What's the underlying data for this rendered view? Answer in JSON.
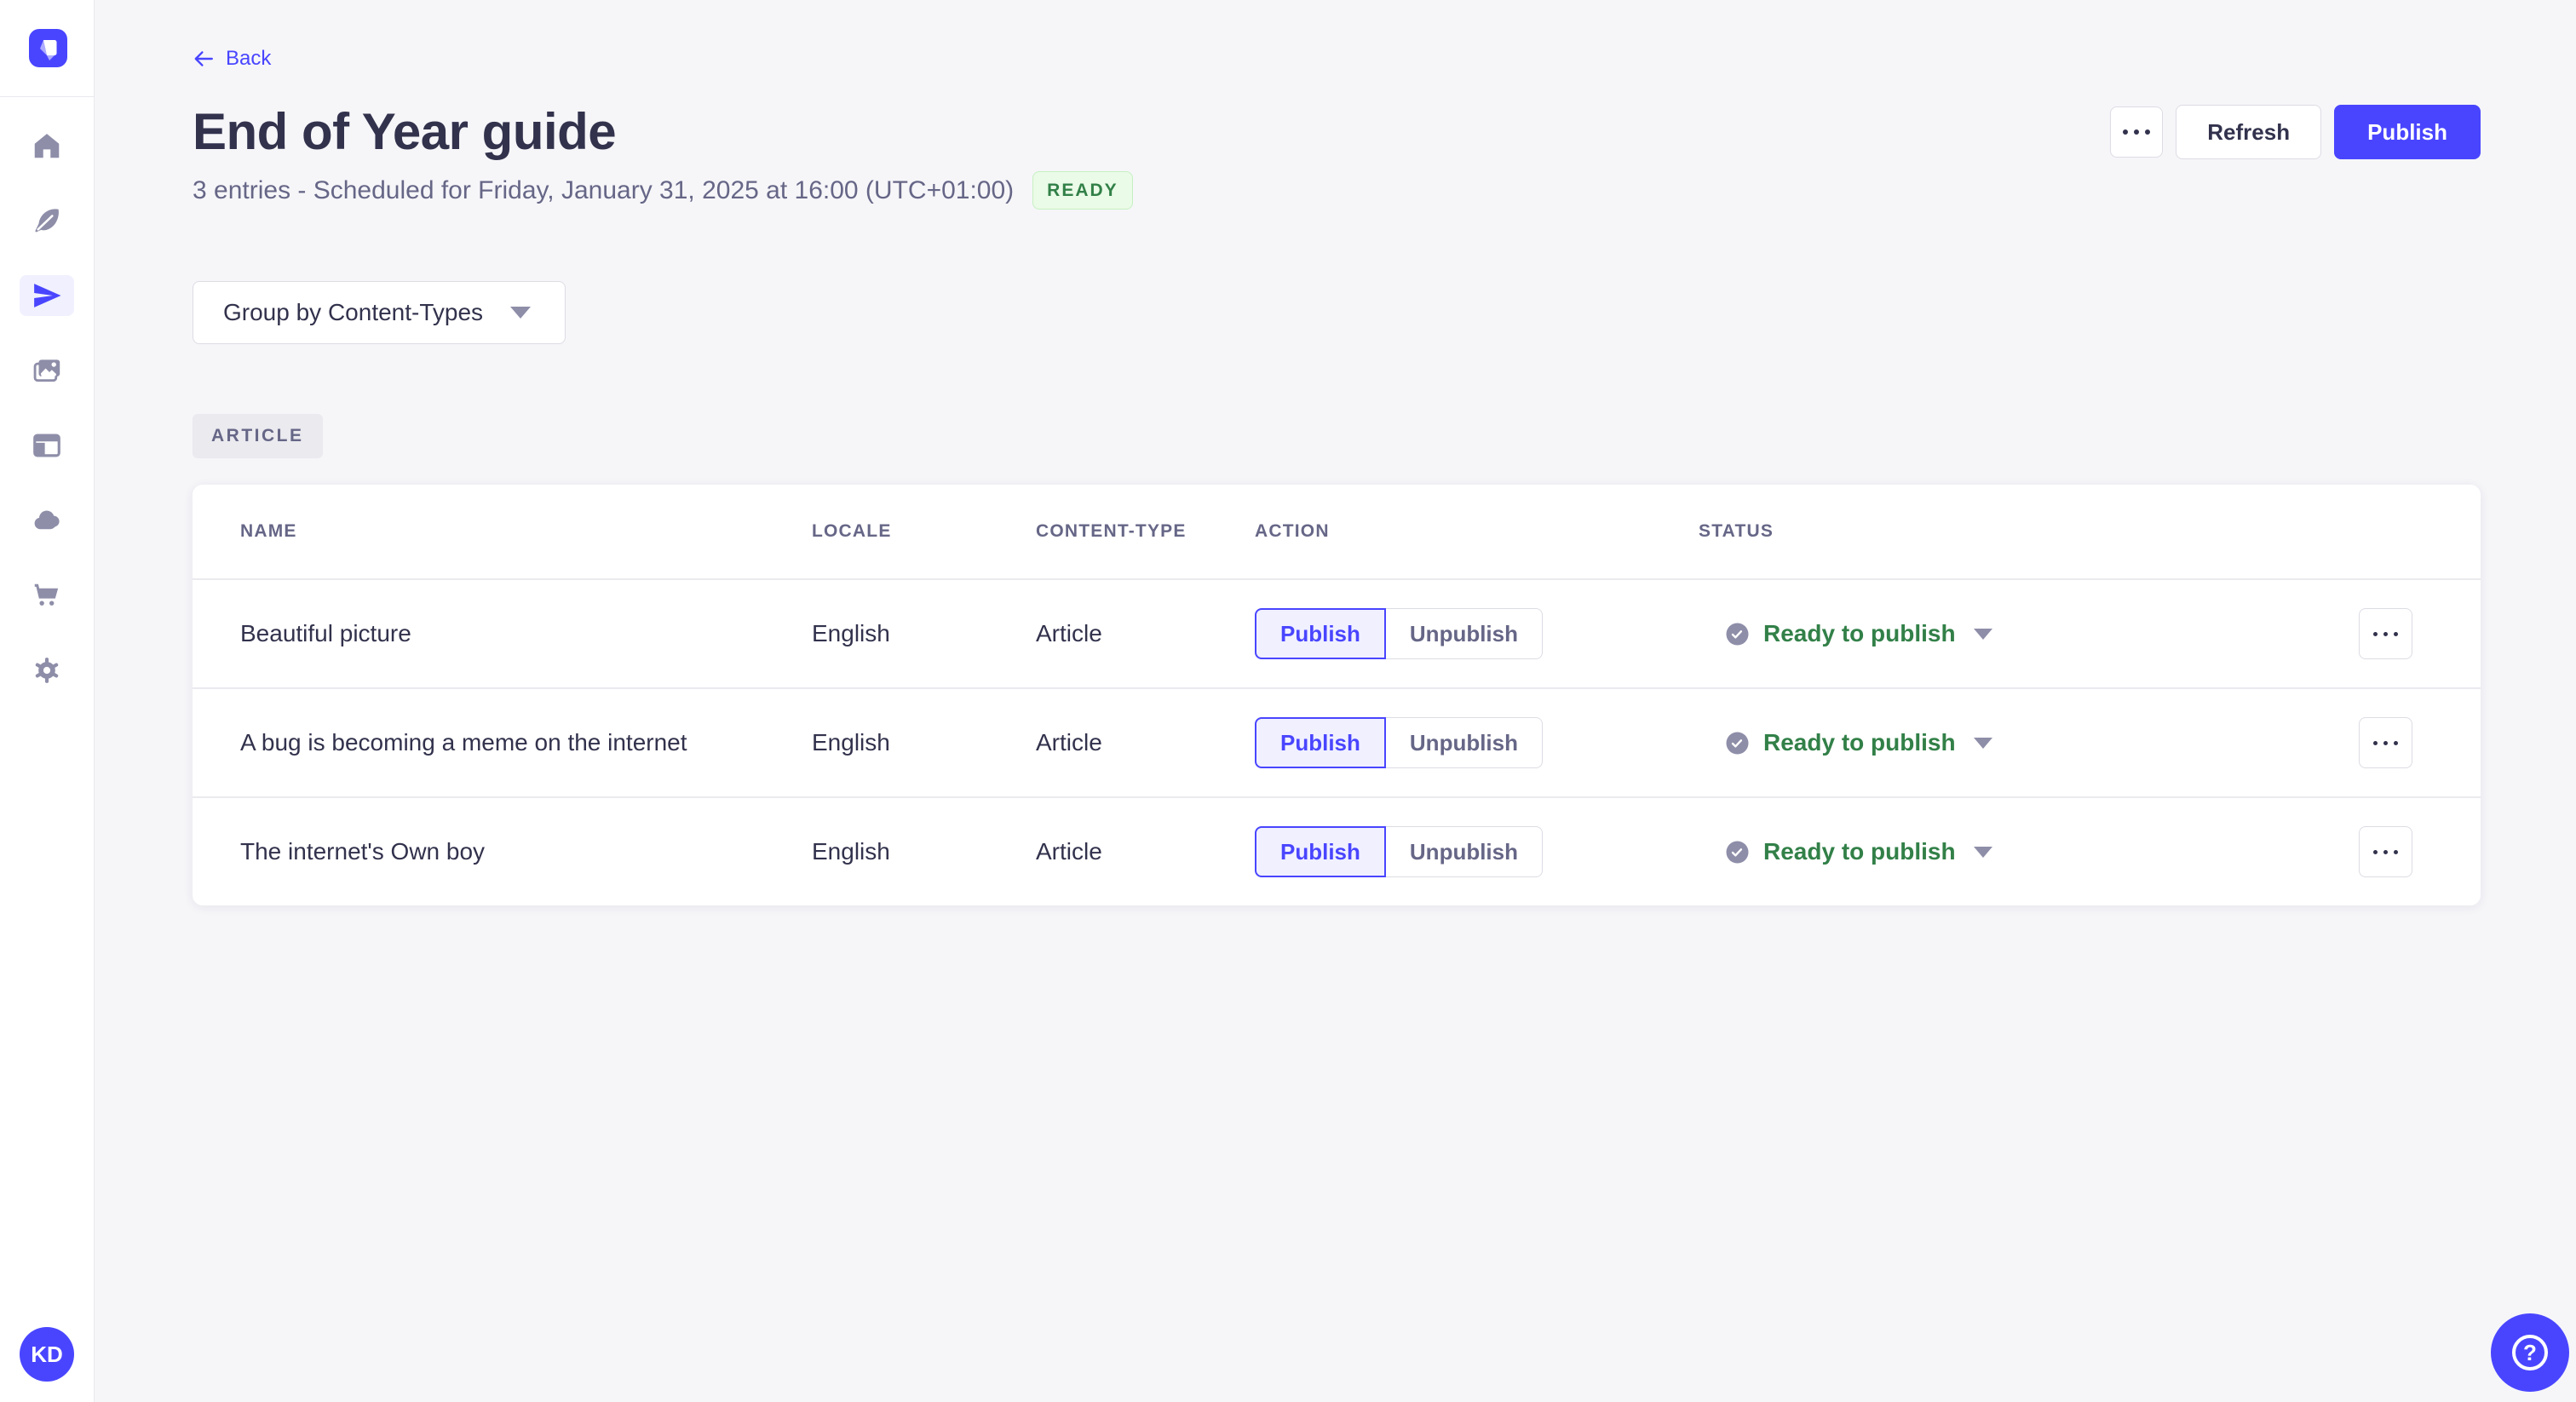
{
  "colors": {
    "primary": "#4945ff",
    "primary_light": "#f0f0ff",
    "success_text": "#328048",
    "success_bg": "#eafbe7",
    "neutral_icon": "#8e8ea9"
  },
  "sidebar": {
    "icons": [
      "home-icon",
      "feather-icon",
      "paper-plane-icon",
      "images-icon",
      "layout-icon",
      "cloud-icon",
      "cart-icon",
      "gear-icon"
    ],
    "active_icon": "paper-plane-icon",
    "avatar_initials": "KD"
  },
  "header": {
    "back_label": "Back",
    "title": "End of Year guide",
    "subtitle": "3 entries - Scheduled for Friday, January 31, 2025 at 16:00 (UTC+01:00)",
    "ready_badge": "READY",
    "more_icon": "ellipsis-icon",
    "refresh_label": "Refresh",
    "publish_label": "Publish"
  },
  "filters": {
    "group_by_label": "Group by Content-Types"
  },
  "group_badge": "ARTICLE",
  "table": {
    "columns": [
      "NAME",
      "LOCALE",
      "CONTENT-TYPE",
      "ACTION",
      "STATUS"
    ],
    "action_labels": {
      "publish": "Publish",
      "unpublish": "Unpublish"
    },
    "rows": [
      {
        "name": "Beautiful picture",
        "locale": "English",
        "content_type": "Article",
        "status": "Ready to publish"
      },
      {
        "name": "A bug is becoming a meme on the internet",
        "locale": "English",
        "content_type": "Article",
        "status": "Ready to publish"
      },
      {
        "name": "The internet's Own boy",
        "locale": "English",
        "content_type": "Article",
        "status": "Ready to publish"
      }
    ]
  },
  "help": {
    "icon": "question-mark-icon",
    "label": "?"
  }
}
